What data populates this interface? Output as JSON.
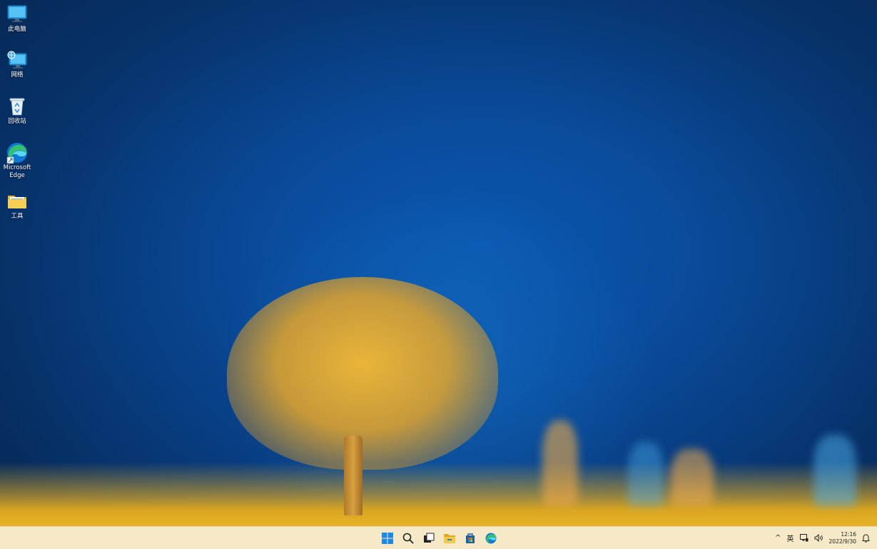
{
  "desktop": {
    "icons": [
      {
        "label": "此电脑",
        "icon": "this-pc-icon"
      },
      {
        "label": "网络",
        "icon": "network-icon"
      },
      {
        "label": "回收站",
        "icon": "recycle-bin-icon"
      },
      {
        "label": "Microsoft Edge",
        "icon": "edge-icon"
      },
      {
        "label": "工具",
        "icon": "folder-icon"
      }
    ]
  },
  "taskbar": {
    "apps": [
      {
        "name": "start",
        "icon": "windows-start-icon"
      },
      {
        "name": "search",
        "icon": "search-icon"
      },
      {
        "name": "task-view",
        "icon": "task-view-icon"
      },
      {
        "name": "file-explorer",
        "icon": "file-explorer-icon"
      },
      {
        "name": "store",
        "icon": "microsoft-store-icon"
      },
      {
        "name": "edge",
        "icon": "edge-icon"
      }
    ],
    "tray": {
      "chevron": "^",
      "ime": "英",
      "time": "12:16",
      "date": "2022/9/30"
    }
  },
  "colors": {
    "taskbar_bg": "#f5e9c8",
    "sky_deep": "#052650",
    "sky_center": "#0a58b0",
    "tree_gold": "#f0b030",
    "windows_blue": "#1e88e5"
  }
}
